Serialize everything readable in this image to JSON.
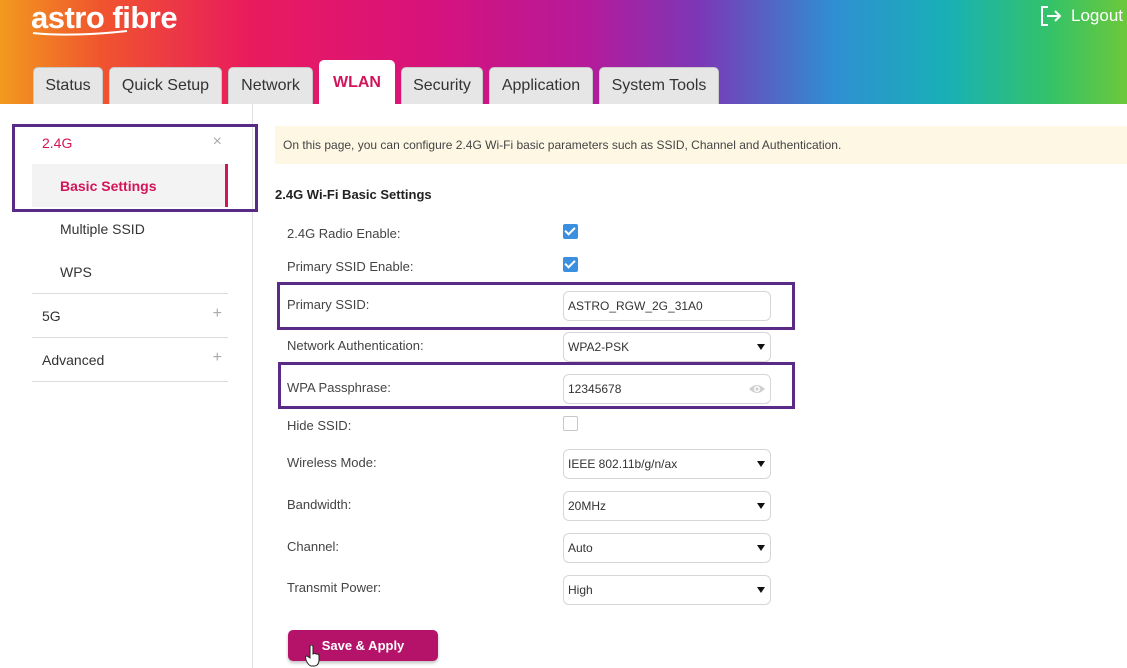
{
  "brand": {
    "logo": "astro fibre"
  },
  "header": {
    "logout_label": "Logout"
  },
  "tabs": [
    {
      "label": "Status"
    },
    {
      "label": "Quick Setup"
    },
    {
      "label": "Network"
    },
    {
      "label": "WLAN"
    },
    {
      "label": "Security"
    },
    {
      "label": "Application"
    },
    {
      "label": "System Tools"
    }
  ],
  "active_tab": "WLAN",
  "sidebar": {
    "groups": [
      {
        "label": "2.4G",
        "toggle": "×",
        "items": [
          "Basic Settings",
          "Multiple SSID",
          "WPS"
        ]
      },
      {
        "label": "5G",
        "toggle": "+"
      },
      {
        "label": "Advanced",
        "toggle": "+"
      }
    ]
  },
  "main": {
    "info": "On this page, you can configure 2.4G Wi-Fi basic parameters such as SSID, Channel and Authentication.",
    "title": "2.4G Wi-Fi Basic Settings",
    "fields": {
      "radio_enable": {
        "label": "2.4G Radio Enable:",
        "checked": true
      },
      "primary_ssid_enable": {
        "label": "Primary SSID Enable:",
        "checked": true
      },
      "primary_ssid": {
        "label": "Primary SSID:",
        "value": "ASTRO_RGW_2G_31A0"
      },
      "network_auth": {
        "label": "Network Authentication:",
        "value": "WPA2-PSK"
      },
      "wpa_passphrase": {
        "label": "WPA Passphrase:",
        "value": "12345678"
      },
      "hide_ssid": {
        "label": "Hide SSID:",
        "checked": false
      },
      "wireless_mode": {
        "label": "Wireless Mode:",
        "value": "IEEE 802.11b/g/n/ax"
      },
      "bandwidth": {
        "label": "Bandwidth:",
        "value": "20MHz"
      },
      "channel": {
        "label": "Channel:",
        "value": "Auto"
      },
      "transmit_power": {
        "label": "Transmit Power:",
        "value": "High"
      }
    },
    "save_label": "Save & Apply"
  },
  "colors": {
    "accent": "#d4145a",
    "button": "#b5136a",
    "highlight": "#5b2a86",
    "checkbox": "#3b8fe0"
  }
}
